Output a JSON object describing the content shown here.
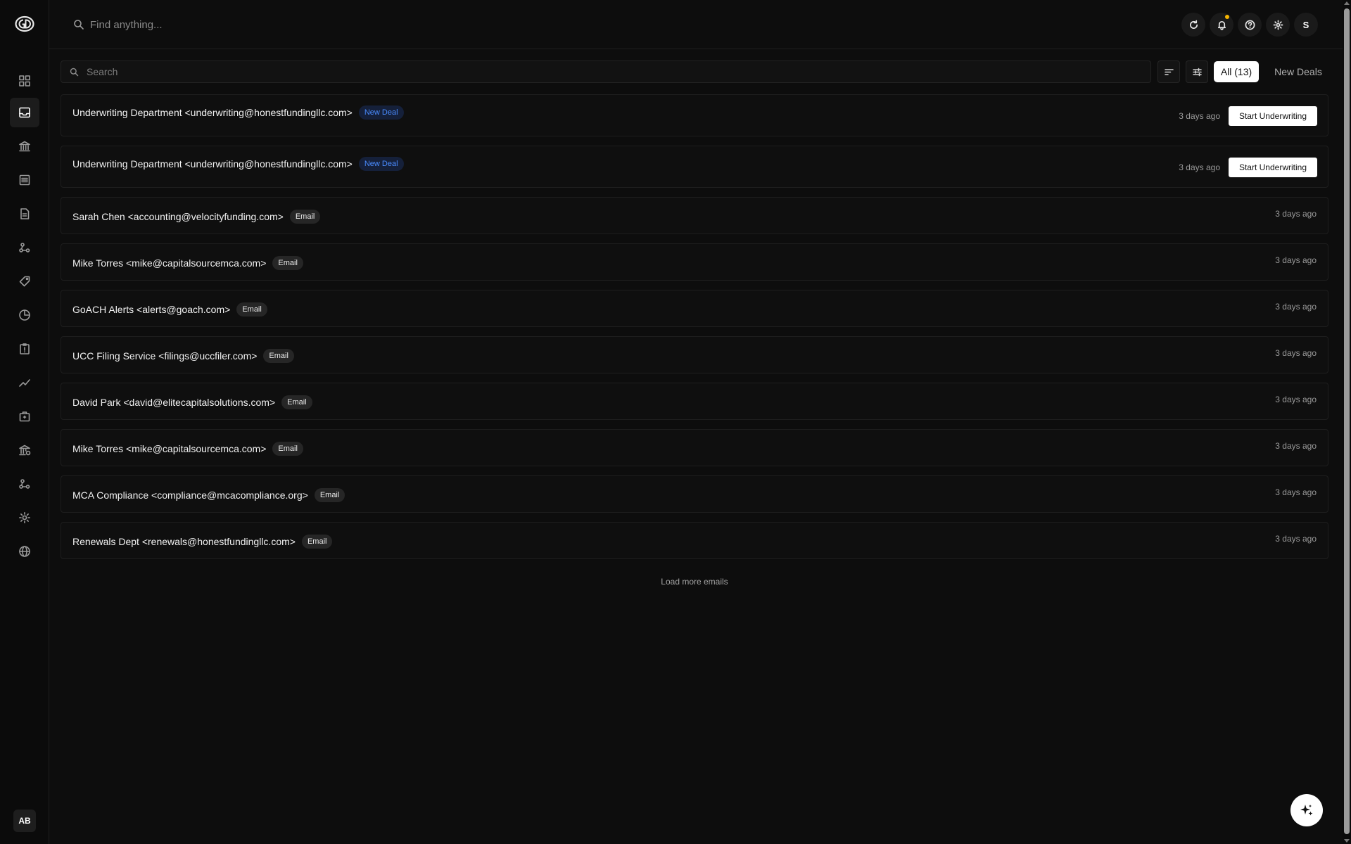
{
  "topbar": {
    "search_placeholder": "Find anything...",
    "avatar_initial": "S",
    "notification_dot_color": "#f5b400"
  },
  "sidebar": {
    "user_initials": "AB",
    "items": [
      {
        "icon": "dashboard-icon"
      },
      {
        "icon": "inbox-icon",
        "active": true
      },
      {
        "icon": "bank-icon"
      },
      {
        "icon": "list-icon"
      },
      {
        "icon": "document-icon"
      },
      {
        "icon": "nodes-icon"
      },
      {
        "icon": "tags-icon"
      },
      {
        "icon": "pie-chart-icon"
      },
      {
        "icon": "clipboard-icon"
      },
      {
        "icon": "trend-line-icon"
      },
      {
        "icon": "briefcase-icon"
      },
      {
        "icon": "bank-check-icon"
      },
      {
        "icon": "network-icon"
      },
      {
        "icon": "gear-icon"
      },
      {
        "icon": "globe-icon"
      }
    ]
  },
  "toolbar": {
    "search_placeholder": "Search",
    "filter_all": "All (13)",
    "filter_new": "New Deals"
  },
  "emails": [
    {
      "sender": "Underwriting Department <underwriting@honestfundingllc.com>",
      "tag": "New Deal",
      "tag_type": "newdeal",
      "time": "3 days ago",
      "action": "Start Underwriting"
    },
    {
      "sender": "Underwriting Department <underwriting@honestfundingllc.com>",
      "tag": "New Deal",
      "tag_type": "newdeal",
      "time": "3 days ago",
      "action": "Start Underwriting"
    },
    {
      "sender": "Sarah Chen <accounting@velocityfunding.com>",
      "tag": "Email",
      "tag_type": "email",
      "time": "3 days ago"
    },
    {
      "sender": "Mike Torres <mike@capitalsourcemca.com>",
      "tag": "Email",
      "tag_type": "email",
      "time": "3 days ago"
    },
    {
      "sender": "GoACH Alerts <alerts@goach.com>",
      "tag": "Email",
      "tag_type": "email",
      "time": "3 days ago"
    },
    {
      "sender": "UCC Filing Service <filings@uccfiler.com>",
      "tag": "Email",
      "tag_type": "email",
      "time": "3 days ago"
    },
    {
      "sender": "David Park <david@elitecapitalsolutions.com>",
      "tag": "Email",
      "tag_type": "email",
      "time": "3 days ago"
    },
    {
      "sender": "Mike Torres <mike@capitalsourcemca.com>",
      "tag": "Email",
      "tag_type": "email",
      "time": "3 days ago"
    },
    {
      "sender": "MCA Compliance <compliance@mcacompliance.org>",
      "tag": "Email",
      "tag_type": "email",
      "time": "3 days ago"
    },
    {
      "sender": "Renewals Dept <renewals@honestfundingllc.com>",
      "tag": "Email",
      "tag_type": "email",
      "time": "3 days ago"
    }
  ],
  "load_more": "Load more emails"
}
